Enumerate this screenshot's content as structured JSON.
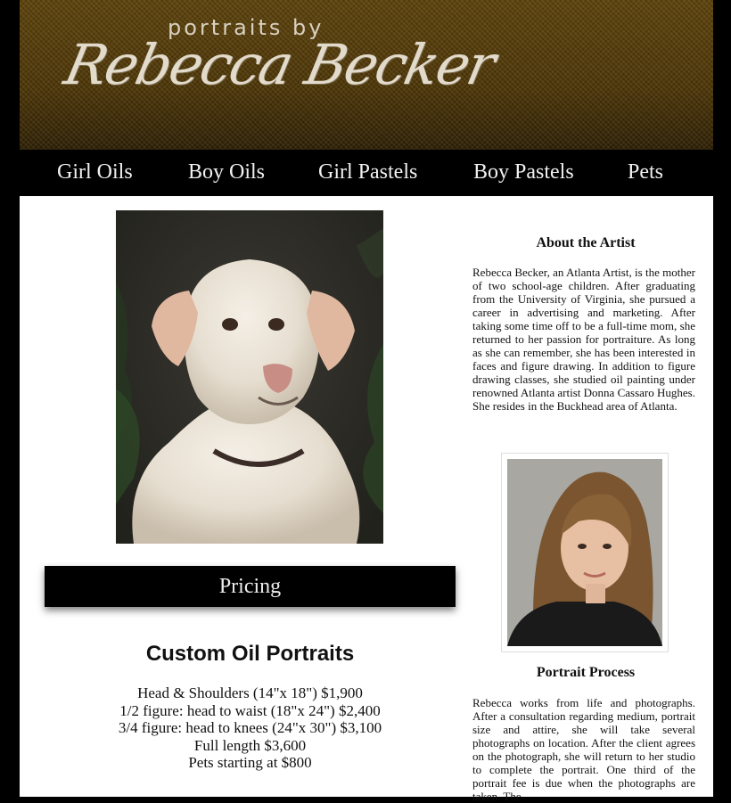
{
  "header": {
    "logo_small": "portraits by",
    "logo_name": "Rebecca Becker"
  },
  "nav": {
    "items": [
      {
        "label": "Girl Oils"
      },
      {
        "label": "Boy Oils"
      },
      {
        "label": "Girl Pastels"
      },
      {
        "label": "Boy Pastels"
      },
      {
        "label": "Pets"
      }
    ]
  },
  "pricing": {
    "button_label": "Pricing",
    "title": "Custom Oil Portraits",
    "lines": [
      "Head & Shoulders (14\"x 18\") $1,900",
      "1/2 figure: head to waist (18\"x 24\") $2,400",
      "3/4 figure: head to knees (24\"x 30\") $3,100",
      "Full length $3,600",
      "Pets starting at $800"
    ]
  },
  "about": {
    "heading": "About the Artist",
    "text": "Rebecca Becker, an Atlanta Artist, is the mother of two school-age children. After graduating from the University of Virginia, she pursued a career in advertising and marketing. After taking some time off to be a full-time mom, she returned to her passion for portraiture. As long as she can remember, she has been interested in faces and figure drawing. In addition to figure drawing classes, she studied oil painting under renowned Atlanta artist Donna Cassaro Hughes. She resides in the Buckhead area of Atlanta."
  },
  "process": {
    "heading": "Portrait Process",
    "text": "Rebecca works from life and photographs. After a consultation regarding medium, portrait size and attire, she will take several photographs on location. After the client agrees on the photograph, she will return to her studio to complete the portrait. One third of the portrait fee is due when the photographs are taken. The"
  },
  "colors": {
    "header_brown": "#4a3305",
    "nav_bg": "#000000",
    "content_bg": "#ffffff"
  }
}
